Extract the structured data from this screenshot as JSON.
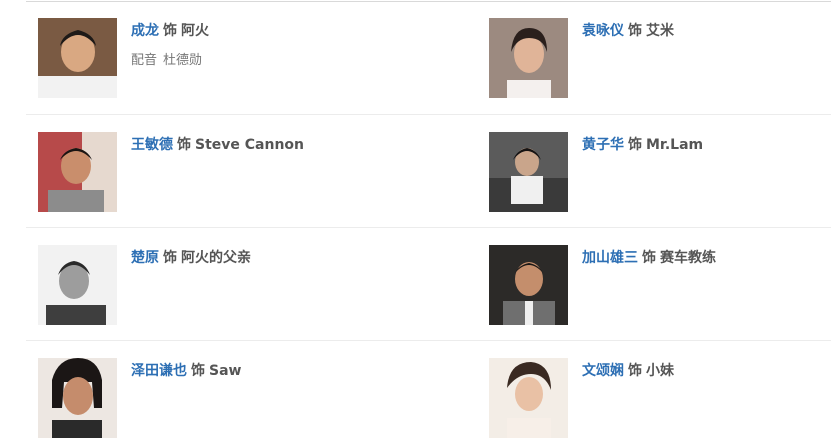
{
  "cast": [
    {
      "actor": "成龙",
      "as": "饰",
      "role": "阿火",
      "voice_label": "配音",
      "voice_actor": "杜德勋"
    },
    {
      "actor": "袁咏仪",
      "as": "饰",
      "role": "艾米"
    },
    {
      "actor": "王敏德",
      "as": "饰",
      "role": "Steve Cannon"
    },
    {
      "actor": "黄子华",
      "as": "饰",
      "role": "Mr.Lam"
    },
    {
      "actor": "楚原",
      "as": "饰",
      "role": "阿火的父亲"
    },
    {
      "actor": "加山雄三",
      "as": "饰",
      "role": "赛车教练"
    },
    {
      "actor": "泽田谦也",
      "as": "饰",
      "role": "Saw"
    },
    {
      "actor": "文颂娴",
      "as": "饰",
      "role": "小妹"
    }
  ],
  "colors": {
    "actor_link": "#2d6fb4",
    "text": "#555555",
    "muted": "#777777",
    "divider": "#ececec"
  }
}
